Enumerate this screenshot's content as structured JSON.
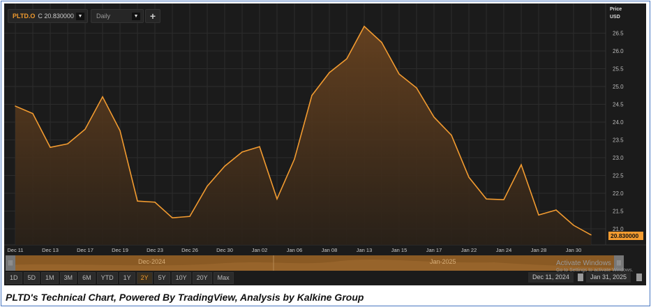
{
  "toolbar": {
    "symbol": "PLTD.O",
    "close_label": "C 20.830000",
    "interval": "Daily",
    "add_label": "+"
  },
  "axis": {
    "price_title": "Price",
    "currency": "USD",
    "last_price": "20.830000"
  },
  "navigator": {
    "month1": "Dec-2024",
    "month2": "Jan-2025"
  },
  "ranges": [
    "1D",
    "5D",
    "1M",
    "3M",
    "6M",
    "YTD",
    "1Y",
    "2Y",
    "5Y",
    "10Y",
    "20Y",
    "Max"
  ],
  "active_range": "2Y",
  "date_from": "Dec 11, 2024",
  "date_to": "Jan 31, 2025",
  "watermark": {
    "title": "Activate Windows",
    "sub": "Go to Settings to activate Windows."
  },
  "caption": "PLTD's Technical Chart, Powered By TradingView, Analysis by Kalkine Group",
  "colors": {
    "line": "#f29b30",
    "last_bg": "#f29b30"
  },
  "chart_data": {
    "type": "area",
    "title": "PLTD.O Daily",
    "xlabel": "",
    "ylabel": "Price USD",
    "ylim": [
      20.7,
      26.9
    ],
    "yticks": [
      "21.0",
      "21.5",
      "22.0",
      "22.5",
      "23.0",
      "23.5",
      "24.0",
      "24.5",
      "25.0",
      "25.5",
      "26.0",
      "26.5"
    ],
    "x": [
      "Dec 11",
      "Dec 12",
      "Dec 13",
      "Dec 16",
      "Dec 17",
      "Dec 18",
      "Dec 19",
      "Dec 20",
      "Dec 23",
      "Dec 24",
      "Dec 26",
      "Dec 27",
      "Dec 30",
      "Dec 31",
      "Jan 02",
      "Jan 03",
      "Jan 06",
      "Jan 07",
      "Jan 08",
      "Jan 10",
      "Jan 13",
      "Jan 14",
      "Jan 15",
      "Jan 16",
      "Jan 17",
      "Jan 21",
      "Jan 22",
      "Jan 23",
      "Jan 24",
      "Jan 27",
      "Jan 28",
      "Jan 29",
      "Jan 30",
      "Jan 31"
    ],
    "xticks": [
      "Dec 11",
      "Dec 13",
      "Dec 17",
      "Dec 19",
      "Dec 23",
      "Dec 26",
      "Dec 30",
      "Jan 02",
      "Jan 06",
      "Jan 08",
      "Jan 13",
      "Jan 15",
      "Jan 17",
      "Jan 22",
      "Jan 24",
      "Jan 28",
      "Jan 30"
    ],
    "values": [
      24.45,
      24.24,
      23.29,
      23.39,
      23.8,
      24.71,
      23.76,
      21.78,
      21.75,
      21.31,
      21.35,
      22.2,
      22.76,
      23.16,
      23.31,
      21.84,
      22.96,
      24.75,
      25.39,
      25.78,
      26.69,
      26.24,
      25.35,
      24.96,
      24.14,
      23.63,
      22.45,
      21.84,
      21.82,
      22.8,
      21.39,
      21.53,
      21.1,
      20.83
    ],
    "grid": true
  }
}
